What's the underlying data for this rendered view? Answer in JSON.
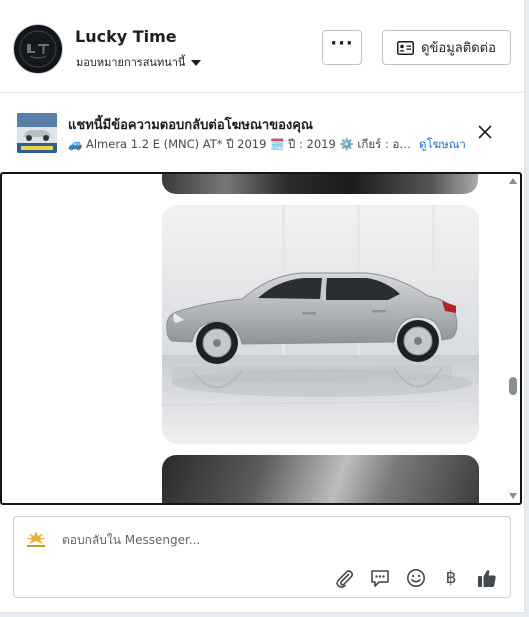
{
  "header": {
    "page_name": "Lucky Time",
    "subtitle": "มอบหมายการสนทนานี้",
    "more_button_label": "···",
    "contact_button_label": "ดูข้อมูลติดต่อ"
  },
  "ad_banner": {
    "title": "แชทนี้มีข้อความตอบกลับต่อโฆษณาของคุณ",
    "detail": "🚙 Almera 1.2 E (MNC) AT* ปี 2019 🗓️ ปี : 2019 ⚙️ เกียร์ : ออโต้ 📱 เช็...",
    "link_label": "ดูโฆษณา"
  },
  "composer": {
    "placeholder": "ตอบกลับใน Messenger...",
    "baht_symbol": "฿"
  },
  "icons": {
    "avatar": "lucky-time-logo",
    "contact": "contact-card-icon",
    "close": "close-icon",
    "attach": "paperclip-icon",
    "saved_reply": "chat-bubble-icon",
    "emoji": "smiley-icon",
    "payment": "baht-icon",
    "like": "thumbs-up-icon"
  },
  "colors": {
    "link": "#216fdb",
    "border": "#141414",
    "like": "#444950"
  }
}
